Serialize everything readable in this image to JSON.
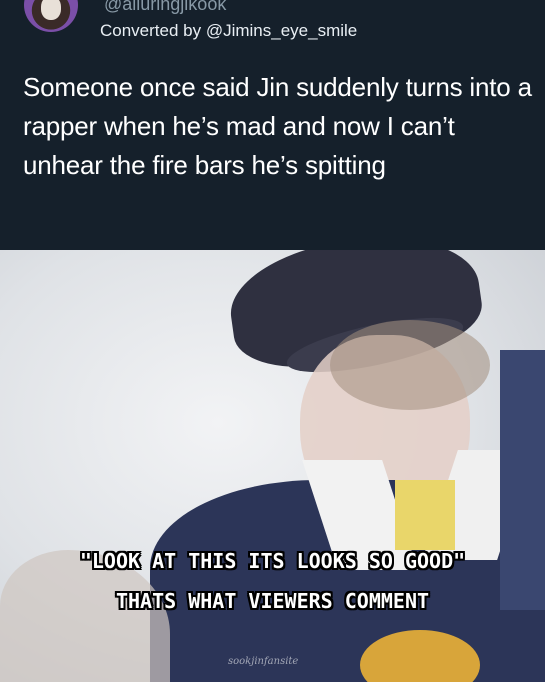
{
  "post": {
    "handle": "@alluringjikook",
    "converted_by": "Converted by @Jimins_eye_smile",
    "text": "Someone once said Jin suddenly turns into a rapper when he’s mad and now I can’t unhear the fire bars he’s spitting"
  },
  "media": {
    "subtitle_line1": "\"LOOK AT THIS ITS LOOKS SO GOOD\"",
    "subtitle_line2": "THATS WHAT VIEWERS COMMENT",
    "watermark": "sookjinfansite"
  },
  "colors": {
    "background": "#15202b",
    "handle": "#8899a6",
    "text": "#ffffff"
  }
}
